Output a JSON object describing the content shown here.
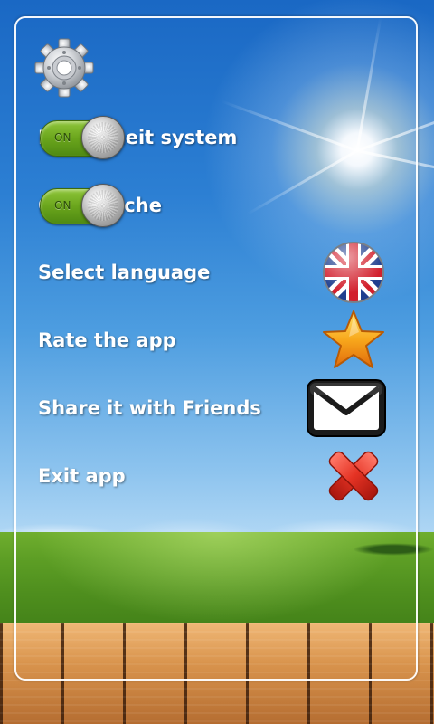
{
  "settings": {
    "items": [
      {
        "label": "Fahrenheit system",
        "control": "toggle",
        "toggle_text": "ON",
        "state": "on"
      },
      {
        "label": "Clear cache",
        "control": "toggle",
        "toggle_text": "ON",
        "state": "on"
      },
      {
        "label": "Select language",
        "control": "icon",
        "icon": "uk-flag-icon"
      },
      {
        "label": "Rate the app",
        "control": "icon",
        "icon": "star-icon"
      },
      {
        "label": "Share it with Friends",
        "control": "icon",
        "icon": "envelope-icon"
      },
      {
        "label": "Exit app",
        "control": "icon",
        "icon": "close-icon"
      }
    ]
  },
  "header": {
    "icon": "gear-icon"
  },
  "colors": {
    "text": "#ffffff",
    "toggle_green": "#6aa51c",
    "panel_border": "#ffffff",
    "star": "#f7a21b",
    "exit_red": "#e53324",
    "flag_blue": "#1f3f8f",
    "flag_red": "#d21f2c"
  }
}
